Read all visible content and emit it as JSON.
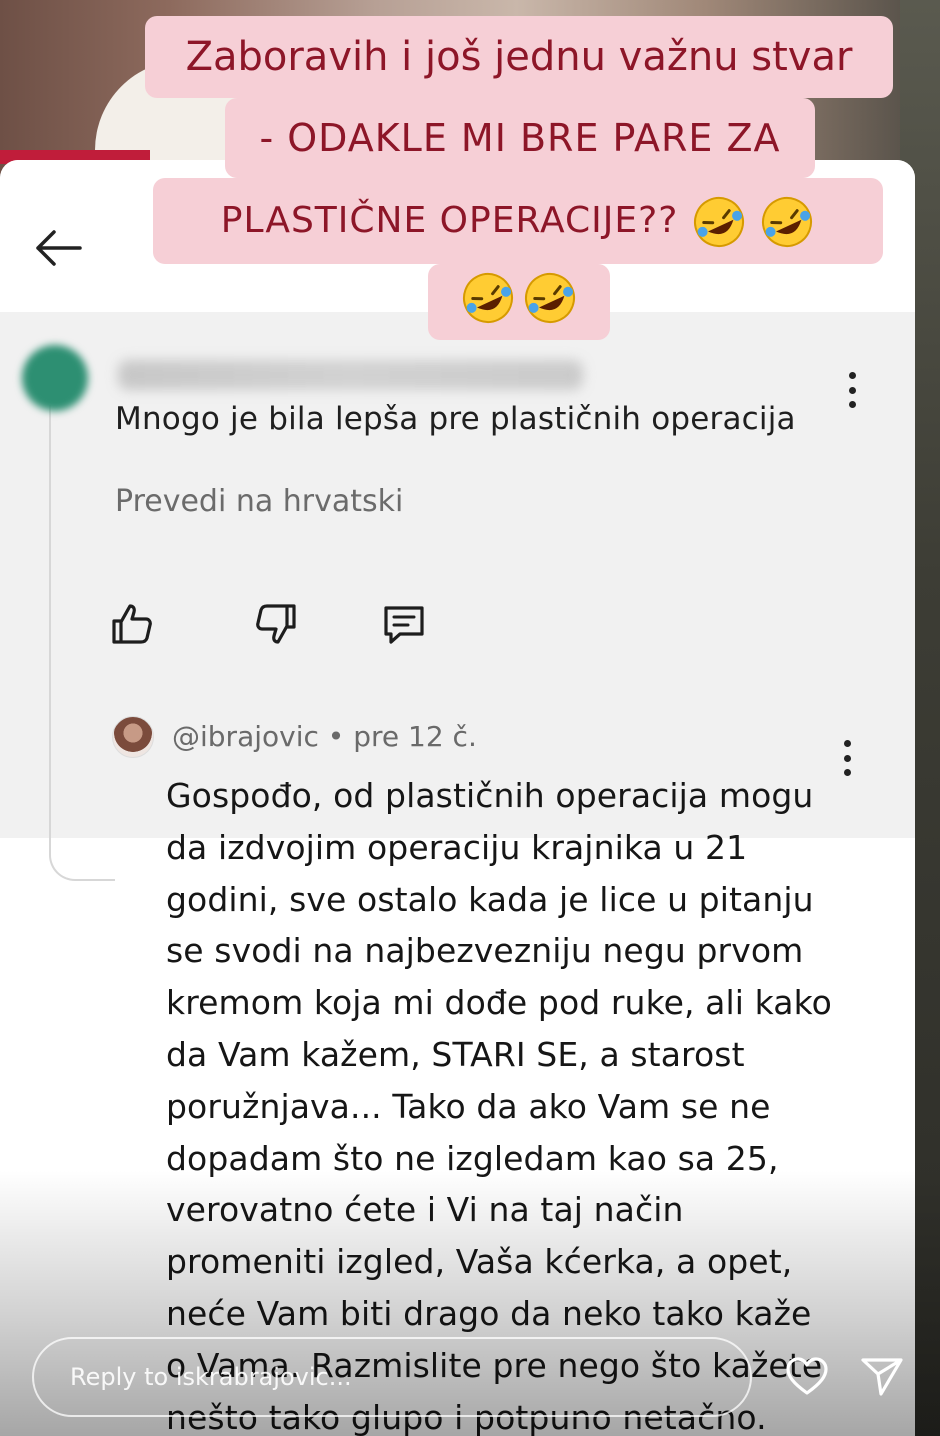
{
  "caption": {
    "line1": "Zaboravih i još jednu važnu stvar",
    "line2": "- ODAKLE MI BRE PARE ZA",
    "line3": "PLASTIČNE OPERACIJE??",
    "emoji_name": "rolling-on-floor-laughing-emoji",
    "colors": {
      "background": "#f6cfd6",
      "text": "#8d1628"
    }
  },
  "comment": {
    "author_blurred": true,
    "text": "Mnogo je bila lepša pre plastičnih operacija",
    "translate_label": "Prevedi na hrvatski",
    "actions": [
      "thumb-up-icon",
      "thumb-down-icon",
      "reply-comment-icon"
    ]
  },
  "reply": {
    "author": "@ibrajovic",
    "separator": "•",
    "time": "pre 12 č.",
    "text": "Gospođo, od plastičnih operacija mogu da izdvojim operaciju krajnika u 21 godini, sve ostalo kada je lice u pitanju se svodi na najbezvezniju negu prvom kremom koja mi dođe pod ruke, ali kako da Vam kažem, STARI SE, a starost poružnjava... Tako da ako Vam se ne dopadam što ne izgledam kao sa 25, verovatno ćete i Vi na taj način promeniti izgled, Vaša kćerka, a opet, neće Vam biti drago da neko tako kaže o Vama. Razmislite pre nego što kažete nešto tako glupo i potpuno netačno."
  },
  "story_bar": {
    "reply_placeholder": "Reply to iskrabrajovic...",
    "icons": [
      "heart-icon",
      "send-icon"
    ]
  },
  "colors": {
    "card_bg": "#ffffff",
    "comment_bg": "#f1f1f1",
    "story_accent_red": "#c01d3a"
  }
}
